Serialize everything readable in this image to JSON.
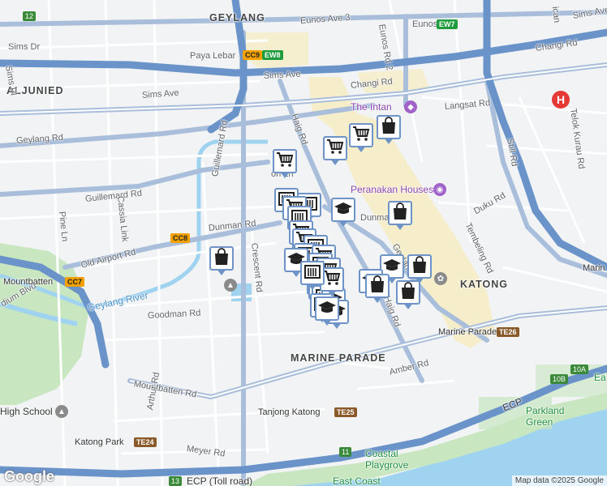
{
  "map": {
    "attribution": "Map data ©2025 Google",
    "logo": "Google",
    "colors": {
      "land": "#f1f3f4",
      "sea": "#9fd3f0",
      "expressway": "#6a93c9",
      "arterial": "#a9bedb",
      "park": "#c8e6c0",
      "commercial": "#f6ecc5",
      "water": "#9fd3f0",
      "marker_border": "#6e94c7",
      "hospital": "#e53935"
    },
    "area_labels": [
      {
        "id": "geylang",
        "text": "GEYLANG"
      },
      {
        "id": "aljunied",
        "text": "ALJUNIED"
      },
      {
        "id": "katong",
        "text": "KATONG"
      },
      {
        "id": "marine-parade",
        "text": "MARINE PARADE"
      }
    ],
    "road_labels": [
      {
        "id": "eunos-ave-3",
        "text": "Eunos Ave 3"
      },
      {
        "id": "eunos-rd-2",
        "text": "Eunos Rd 2"
      },
      {
        "id": "eunos",
        "text": "Eunos"
      },
      {
        "id": "sims-dr",
        "text": "Sims Dr"
      },
      {
        "id": "sims-pl",
        "text": "Sims Pl"
      },
      {
        "id": "sims-ave-top",
        "text": "Sims Ave"
      },
      {
        "id": "sims-ave-left",
        "text": "Sims Ave"
      },
      {
        "id": "changi-rd",
        "text": "Changi Rd"
      },
      {
        "id": "changi-rd-2",
        "text": "Changi Rd"
      },
      {
        "id": "sims-ave-e",
        "text": "Sims Ave E"
      },
      {
        "id": "paya-lebar",
        "text": "Paya Lebar"
      },
      {
        "id": "geylang-rd",
        "text": "Geylang Rd"
      },
      {
        "id": "guillemard-rd-v",
        "text": "Guillemard Rd"
      },
      {
        "id": "guillemard-rd-h",
        "text": "Guillemard Rd"
      },
      {
        "id": "haig-rd",
        "text": "Haig Rd"
      },
      {
        "id": "haig-rd-2",
        "text": "Haig Rd"
      },
      {
        "id": "langsat-rd",
        "text": "Langsat Rd"
      },
      {
        "id": "still-rd",
        "text": "Still Rd"
      },
      {
        "id": "telok-kurau",
        "text": "Telok Kurau Rd"
      },
      {
        "id": "cassia-link",
        "text": "Cassia Link"
      },
      {
        "id": "pine-ln",
        "text": "Pine Ln"
      },
      {
        "id": "dunman-rd",
        "text": "Dunman Rd"
      },
      {
        "id": "dunman-rd-2",
        "text": "Dunman"
      },
      {
        "id": "old-airport-rd",
        "text": "Old Airport Rd"
      },
      {
        "id": "crescent-rd",
        "text": "Crescent Rd"
      },
      {
        "id": "duku-rd",
        "text": "Duku Rd"
      },
      {
        "id": "tembeling-rd",
        "text": "Tembeling Rd"
      },
      {
        "id": "goodman-rd",
        "text": "Goodman Rd"
      },
      {
        "id": "mountbatten-rd",
        "text": "Mountbatten Rd"
      },
      {
        "id": "amber-rd",
        "text": "Amber Rd"
      },
      {
        "id": "arthur-rd",
        "text": "Arthur Rd"
      },
      {
        "id": "meyer-rd",
        "text": "Meyer Rd"
      },
      {
        "id": "ecp-toll",
        "text": "ECP (Toll road)"
      },
      {
        "id": "ecp",
        "text": "ECP"
      },
      {
        "id": "stadium-blvd",
        "text": "dium Blvd"
      },
      {
        "id": "marine-parade-stn",
        "text": "Marine Parade"
      },
      {
        "id": "tanjong-katong",
        "text": "Tanjong Katong"
      },
      {
        "id": "katong-park",
        "text": "Katong Park"
      },
      {
        "id": "mountbatten",
        "text": "Mountbatten"
      },
      {
        "id": "marin",
        "text": "Marin"
      },
      {
        "id": "geylang-mid",
        "text": "Geylan"
      },
      {
        "id": "koh-ln",
        "text": "oh Ln"
      },
      {
        "id": "ican",
        "text": "ican"
      },
      {
        "id": "ea",
        "text": "Ea"
      }
    ],
    "poi_labels": [
      {
        "id": "the-intan",
        "text": "The Intan"
      },
      {
        "id": "peranakan-houses",
        "text": "Peranakan Houses"
      }
    ],
    "green_labels": [
      {
        "id": "parkland-green",
        "text": "Parkland\nGreen"
      },
      {
        "id": "coastal-playgrove",
        "text": "Coastal\nPlaygrove"
      },
      {
        "id": "east-coast",
        "text": "East Coast"
      }
    ],
    "water_labels": [
      {
        "id": "geylang-river",
        "text": "Geylang River"
      }
    ],
    "school_labels": [
      {
        "id": "high-school",
        "text": "High School"
      }
    ],
    "station_badges": [
      {
        "id": "cc9",
        "text": "CC9",
        "type": "cc"
      },
      {
        "id": "ew8",
        "text": "EW8",
        "type": "ew"
      },
      {
        "id": "ew7",
        "text": "EW7",
        "type": "ew"
      },
      {
        "id": "cc8",
        "text": "CC8",
        "type": "cc"
      },
      {
        "id": "cc7",
        "text": "CC7",
        "type": "cc"
      },
      {
        "id": "te26",
        "text": "TE26",
        "type": "te"
      },
      {
        "id": "te25",
        "text": "TE25",
        "type": "te"
      },
      {
        "id": "te24",
        "text": "TE24",
        "type": "te"
      }
    ],
    "route_shields": [
      {
        "id": "r12",
        "text": "12"
      },
      {
        "id": "r11",
        "text": "11"
      },
      {
        "id": "r13",
        "text": "13"
      },
      {
        "id": "r10a",
        "text": "10A"
      },
      {
        "id": "r10b",
        "text": "10B"
      }
    ],
    "markers_legend": {
      "cart": "grocery-cart-icon",
      "bag": "shopping-bag-icon",
      "school": "school-cap-icon",
      "store": "department-store-icon"
    },
    "marker_count": 34
  }
}
